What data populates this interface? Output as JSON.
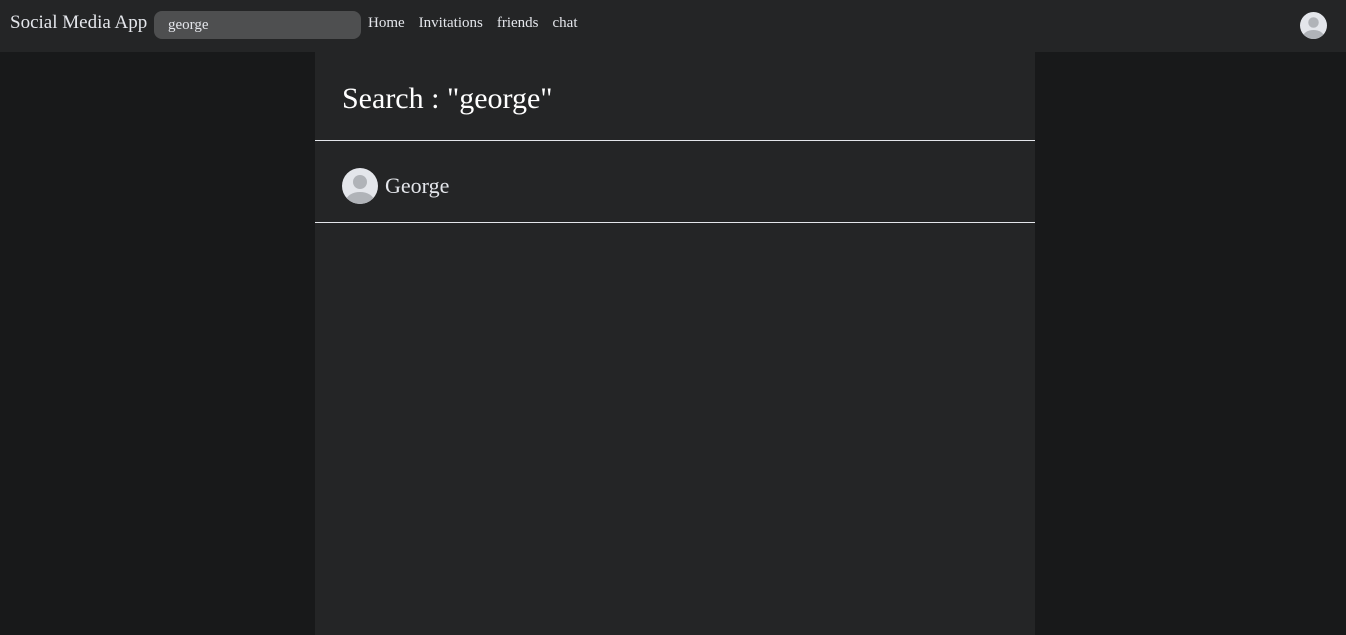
{
  "navbar": {
    "brand": "Social Media App",
    "search": {
      "value": "george",
      "placeholder": ""
    },
    "links": [
      {
        "label": "Home"
      },
      {
        "label": "Invitations"
      },
      {
        "label": "friends"
      },
      {
        "label": "chat"
      }
    ],
    "avatar_icon": "user-avatar-icon"
  },
  "main": {
    "title": "Search : \"george\"",
    "results": [
      {
        "name": "George",
        "avatar_icon": "user-avatar-icon"
      }
    ]
  },
  "colors": {
    "page_background": "#18191a",
    "surface": "#242526",
    "search_background": "#4e4f50",
    "text": "#e4e6eb",
    "avatar_background": "#e4e6eb",
    "avatar_silhouette": "#b0b3b8"
  }
}
